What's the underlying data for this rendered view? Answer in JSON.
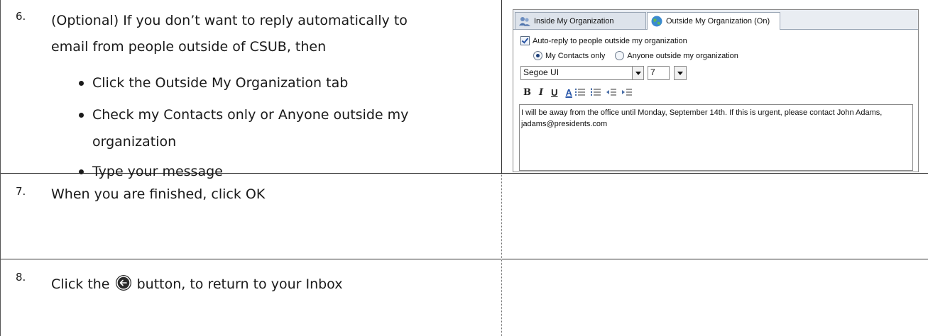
{
  "steps": [
    {
      "number": "6.",
      "text_line1": "(Optional) If you don’t want to reply automatically to",
      "text_line2": "email from people outside of CSUB, then",
      "bullets": [
        "Click the Outside My Organization tab",
        "Check my Contacts only or Anyone outside my",
        "organization",
        "Type your message"
      ]
    },
    {
      "number": "7.",
      "text": "When you are finished, click OK"
    },
    {
      "number": "8.",
      "text_before": "Click the",
      "text_after": "button, to return to your Inbox",
      "icon": "back-arrow-circle-icon"
    }
  ],
  "outlook_pane": {
    "tabs": [
      {
        "label": "Inside My Organization",
        "icon": "people-icon",
        "active": false
      },
      {
        "label": "Outside My Organization (On)",
        "icon": "globe-icon",
        "active": true
      }
    ],
    "auto_reply_label": "Auto-reply to people outside my organization",
    "auto_reply_checked": true,
    "radio_options": [
      {
        "label": "My Contacts only",
        "selected": true
      },
      {
        "label": "Anyone outside my organization",
        "selected": false
      }
    ],
    "font_name": "Segoe UI",
    "font_size": "7",
    "format_buttons": [
      "B",
      "I",
      "U",
      "A"
    ],
    "message": "I will be away from the office until Monday, September 14th.  If this is urgent, please contact John Adams, jadams@presidents.com"
  }
}
